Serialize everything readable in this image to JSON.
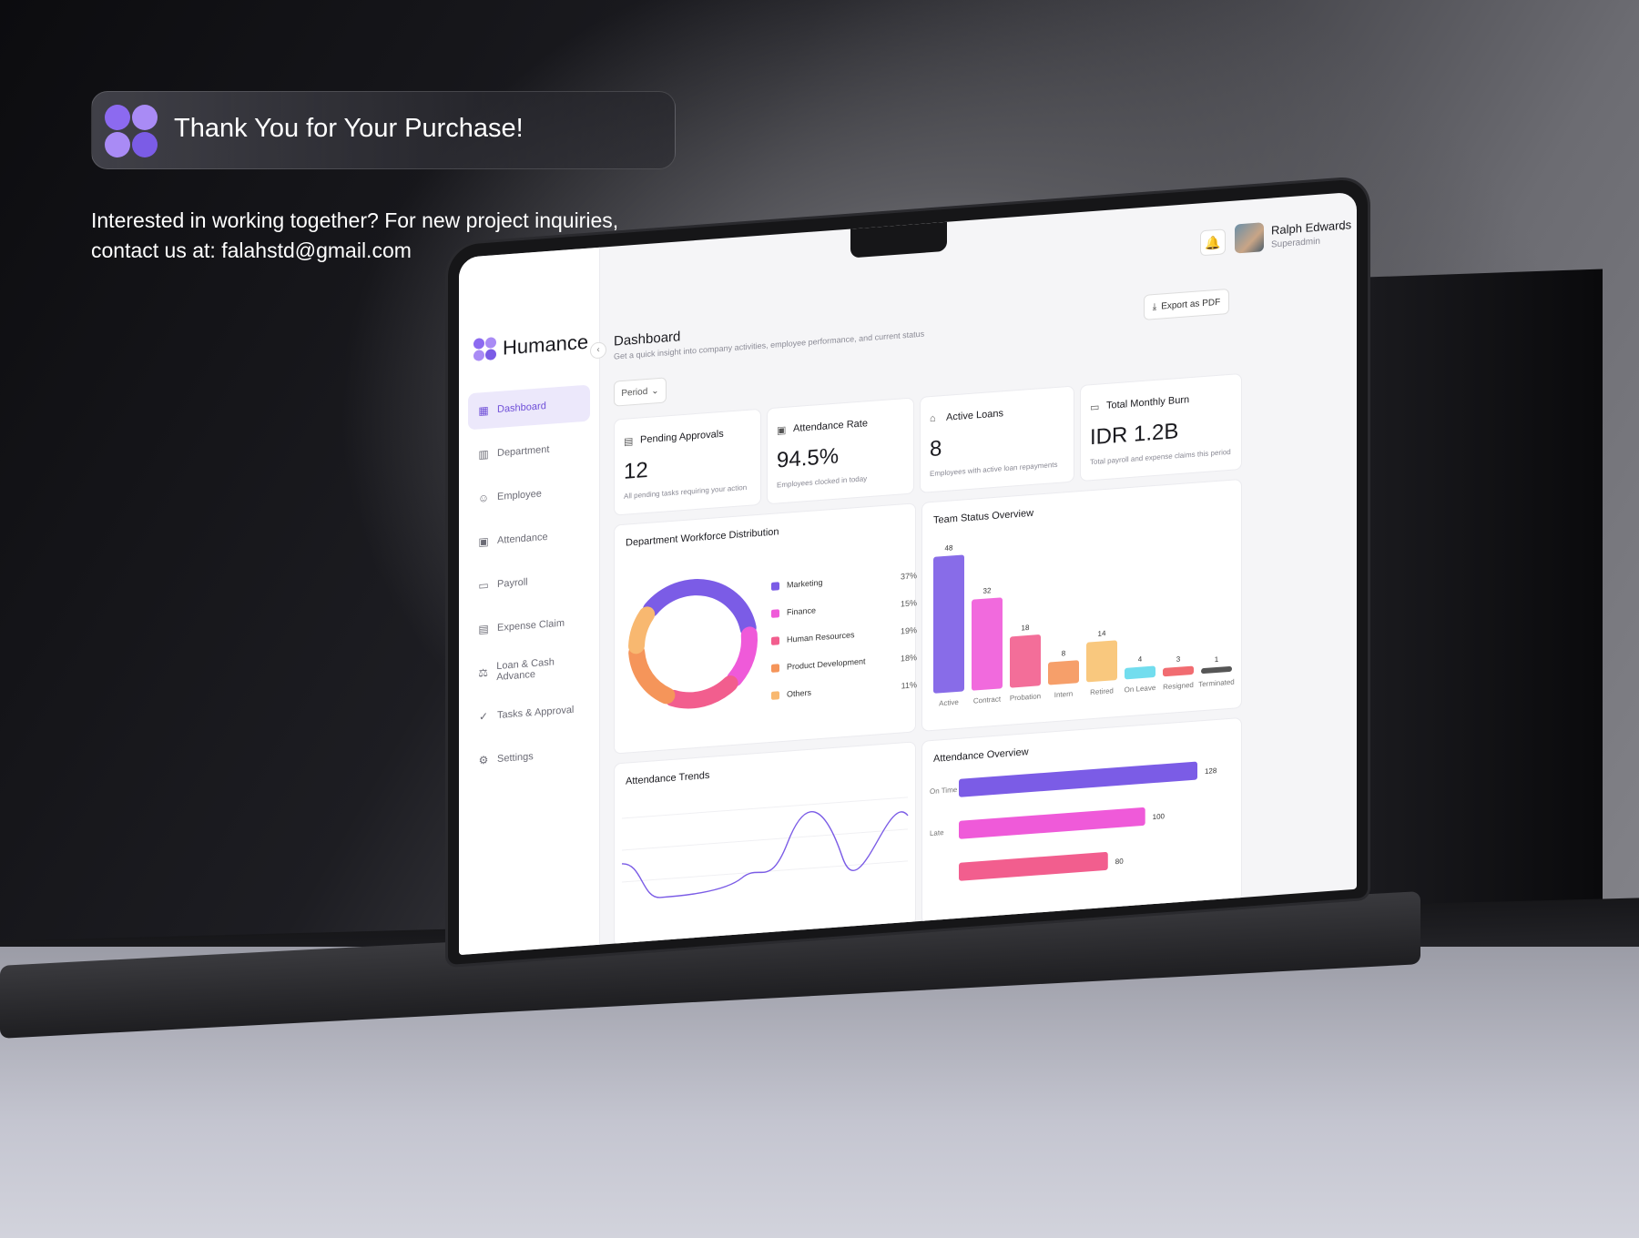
{
  "banner": {
    "title": "Thank You for Your Purchase!",
    "contact_line1": "Interested in working together? For new project inquiries,",
    "contact_line2": "contact us at:  falahstd@gmail.com"
  },
  "colors": {
    "brand": "#7b5ce6",
    "pink": "#ef5ad9",
    "rose": "#f25e8e",
    "orange": "#f5a05a",
    "amber": "#f8c270",
    "cyan": "#63d9ec",
    "red": "#ef5c62",
    "dark": "#333333"
  },
  "app": {
    "brand_name": "Humance",
    "nav": [
      {
        "label": "Dashboard",
        "icon": "layout-icon"
      },
      {
        "label": "Department",
        "icon": "building-icon"
      },
      {
        "label": "Employee",
        "icon": "users-icon"
      },
      {
        "label": "Attendance",
        "icon": "id-card-icon"
      },
      {
        "label": "Payroll",
        "icon": "money-icon"
      },
      {
        "label": "Expense Claim",
        "icon": "receipt-icon"
      },
      {
        "label": "Loan & Cash Advance",
        "icon": "scale-icon"
      },
      {
        "label": "Tasks & Approval",
        "icon": "check-circle-icon"
      },
      {
        "label": "Settings",
        "icon": "gear-icon"
      }
    ],
    "user": {
      "name": "Ralph Edwards",
      "role": "Superadmin"
    },
    "page": {
      "title": "Dashboard",
      "subtitle": "Get a quick insight into company activities, employee performance, and current status"
    },
    "export_label": "Export as PDF",
    "period_label": "Period",
    "stats": [
      {
        "label": "Pending Approvals",
        "value": "12",
        "note": "All pending tasks requiring your action"
      },
      {
        "label": "Attendance Rate",
        "value": "94.5%",
        "note": "Employees clocked in today"
      },
      {
        "label": "Active Loans",
        "value": "8",
        "note": "Employees with active loan repayments"
      },
      {
        "label": "Total Monthly Burn",
        "value": "IDR 1.2B",
        "note": "Total payroll and expense claims this period"
      }
    ],
    "workforce": {
      "title": "Department Workforce Distribution",
      "items": [
        {
          "name": "Marketing",
          "pct": "37%",
          "color": "#7b5ce6"
        },
        {
          "name": "Finance",
          "pct": "15%",
          "color": "#ef5ad9"
        },
        {
          "name": "Human Resources",
          "pct": "19%",
          "color": "#f25e8e"
        },
        {
          "name": "Product Development",
          "pct": "18%",
          "color": "#f5955a"
        },
        {
          "name": "Others",
          "pct": "11%",
          "color": "#f8b870"
        }
      ]
    },
    "team_status": {
      "title": "Team Status Overview"
    },
    "attendance_trends": {
      "title": "Attendance Trends"
    },
    "attendance_overview": {
      "title": "Attendance Overview"
    }
  },
  "chart_data": [
    {
      "type": "pie",
      "title": "Department Workforce Distribution",
      "categories": [
        "Marketing",
        "Finance",
        "Human Resources",
        "Product Development",
        "Others"
      ],
      "values": [
        37,
        15,
        19,
        18,
        11
      ]
    },
    {
      "type": "bar",
      "title": "Team Status Overview",
      "categories": [
        "Active",
        "Contract",
        "Probation",
        "Intern",
        "Retired",
        "On Leave",
        "Resigned",
        "Terminated"
      ],
      "values": [
        48,
        32,
        18,
        8,
        14,
        4,
        3,
        1
      ],
      "colors": [
        "#7b5ce6",
        "#ef5ad9",
        "#f25e8e",
        "#f5955a",
        "#f8c270",
        "#63d9ec",
        "#ef5c62",
        "#444444"
      ],
      "ylim": [
        0,
        48
      ]
    },
    {
      "type": "bar",
      "title": "Attendance Overview",
      "orientation": "horizontal",
      "categories": [
        "On Time",
        "Late",
        ""
      ],
      "values": [
        128,
        100,
        80
      ],
      "colors": [
        "#7b5ce6",
        "#ef5ad9",
        "#f25e8e"
      ],
      "xlim": [
        0,
        128
      ]
    },
    {
      "type": "line",
      "title": "Attendance Trends"
    }
  ]
}
